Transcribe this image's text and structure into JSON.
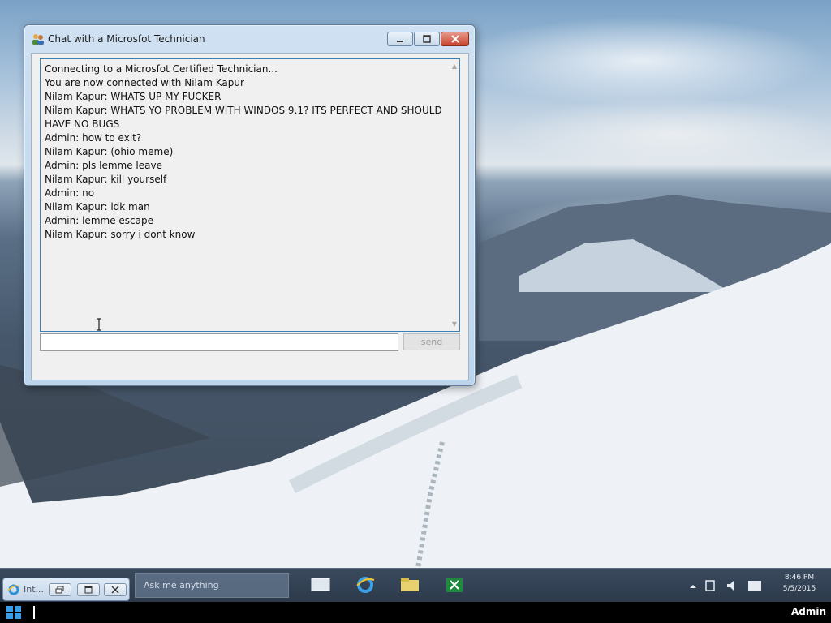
{
  "window": {
    "title": "Chat with a Microsfot Technician",
    "icon": "users-icon"
  },
  "chat": {
    "lines": [
      "Connecting to a Microsfot Certified Technician...",
      "You are now connected with Nilam Kapur",
      "Nilam Kapur: WHATS UP MY FUCKER",
      "Nilam Kapur: WHATS YO PROBLEM WITH WINDOS 9.1? ITS PERFECT AND SHOULD HAVE NO BUGS",
      "Admin: how to exit?",
      "Nilam Kapur: (ohio meme)",
      "Admin: pls lemme leave",
      "Nilam Kapur: kill yourself",
      "Admin: no",
      "Nilam Kapur: idk man",
      "Admin: lemme escape",
      "Nilam Kapur: sorry i dont know"
    ],
    "input_value": "",
    "send_label": "send"
  },
  "taskbar": {
    "search_text": "Ask me anything",
    "clock_time": "8:46 PM",
    "clock_date": "5/5/2015",
    "pinned_icons": [
      "window-icon",
      "internet-explorer-icon",
      "file-explorer-icon",
      "excel-icon"
    ],
    "tray_icons": [
      "chevron-up-icon",
      "network-icon",
      "volume-icon",
      "notifications-icon"
    ]
  },
  "minimized_app": {
    "title": "Int...",
    "icon": "internet-explorer-icon"
  },
  "user": {
    "name": "Admin"
  }
}
